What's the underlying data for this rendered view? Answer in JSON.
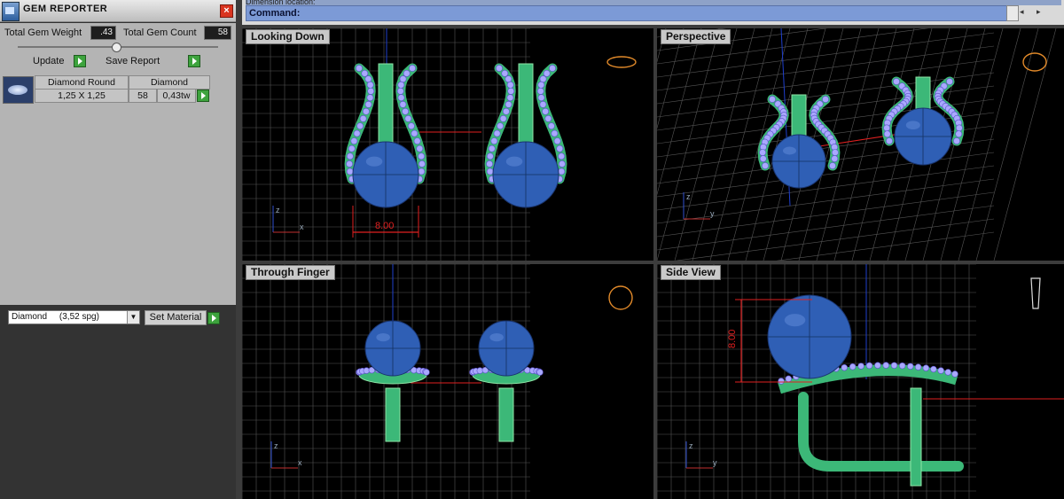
{
  "panel": {
    "title": "GEM REPORTER",
    "close": "×",
    "total_weight_label": "Total Gem Weight",
    "total_weight_value": ".43",
    "total_count_label": "Total Gem Count",
    "total_count_value": "58",
    "update_label": "Update",
    "save_report_label": "Save Report",
    "gem_rows": [
      {
        "type": "Diamond Round",
        "material": "Diamond",
        "size": "1,25 X 1,25",
        "count": "58",
        "weight": "0,43tw"
      }
    ],
    "material_select": "Diamond     (3,52 spg)",
    "set_material_label": "Set Material"
  },
  "command": {
    "top_text": "Dimension location:",
    "label": "Command:",
    "scroll_arrows": "◂ ▸"
  },
  "viewports": [
    {
      "label": "Looking Down",
      "dimension": "8.00"
    },
    {
      "label": "Perspective"
    },
    {
      "label": "Through Finger"
    },
    {
      "label": "Side View",
      "dimension": "8.00"
    }
  ],
  "axis_labels": {
    "x": "x",
    "y": "y",
    "z": "z"
  },
  "colors": {
    "panel_bg": "#b4b4b4",
    "command_bar": "#7c9ad6",
    "viewport_bg": "#000000",
    "grid": "#555555",
    "band": "#3cb878",
    "band_light": "#8ee6a6",
    "pearl": "#2f5fb5",
    "gem": "#a9a8ff",
    "dimension": "#e02020",
    "axis_line": "#1f3fcc"
  }
}
